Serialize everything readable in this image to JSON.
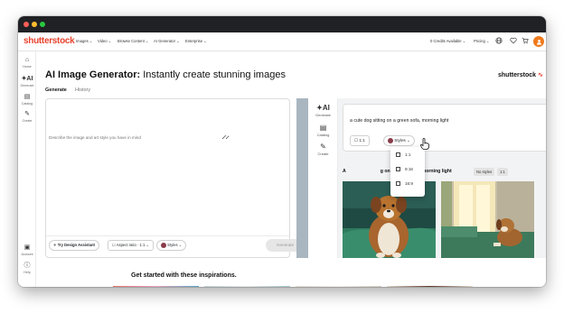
{
  "window_controls": {
    "close_color": "#ff5f57",
    "minimize_color": "#febc2e",
    "maximize_color": "#28c840"
  },
  "nav": {
    "logo": "shutterstock",
    "items": [
      "Images",
      "Video",
      "Browse Content",
      "AI Generator",
      "Enterprise"
    ],
    "credits": "0 Credits Available",
    "pricing": "Pricing",
    "avatar_icon": "user-icon",
    "icons": [
      "globe-icon",
      "heart-icon",
      "cart-icon"
    ]
  },
  "rail": {
    "items": [
      {
        "label": "Home",
        "icon": "home-icon"
      },
      {
        "label": "Generate",
        "icon": "ai-icon"
      },
      {
        "label": "Catalog",
        "icon": "catalog-icon"
      },
      {
        "label": "Create",
        "icon": "create-icon"
      },
      {
        "label": "Account",
        "icon": "account-icon"
      },
      {
        "label": "Help",
        "icon": "help-icon"
      }
    ]
  },
  "page": {
    "title_bold": "AI Image Generator:",
    "title_rest": " Instantly create stunning images",
    "brand": "shutterstock",
    "tabs": [
      "Generate",
      "History"
    ],
    "active_tab": "Generate"
  },
  "prompt": {
    "placeholder": "Describe the image and art style you have in mind",
    "assistant_label": "Try Design Assistant",
    "aspect_label": "Aspect ratio · 1:1",
    "styles_label": "Styles",
    "generate_label": "Generate"
  },
  "preview": {
    "rail": [
      {
        "label": "Generate",
        "icon": "ai-icon"
      },
      {
        "label": "Catalog",
        "icon": "catalog-icon"
      },
      {
        "label": "Create",
        "icon": "create-icon"
      }
    ],
    "prompt_text": "a cute dog sitting on a green sofa, morning light",
    "ratio_label": "1:1",
    "styles_label": "Styles",
    "dropdown_options": [
      "1:1",
      "9:16",
      "16:9"
    ],
    "result_prefix": "A",
    "result_title": "g on a green sofa, morning light",
    "tags": [
      "No styles",
      "1:1"
    ]
  },
  "inspirations": {
    "title": "Get started with these inspirations."
  },
  "colors": {
    "brand_red": "#e8432e",
    "avatar_orange": "#f07a1c"
  }
}
